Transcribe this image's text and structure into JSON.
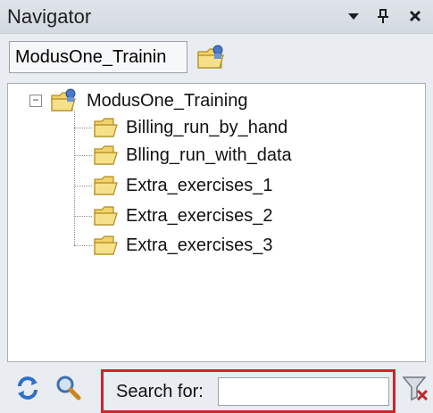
{
  "window": {
    "title": "Navigator"
  },
  "titlebar_icons": [
    "dropdown-arrow-icon",
    "pin-icon",
    "close-icon"
  ],
  "toolbar": {
    "root_value": "ModusOne_Trainin"
  },
  "tree": {
    "root": {
      "label": "ModusOne_Training",
      "expanded": true,
      "expander_glyph": "−"
    },
    "children": [
      {
        "label": "Billing_run_by_hand"
      },
      {
        "label": "Blling_run_with_data"
      },
      {
        "label": "Extra_exercises_1"
      },
      {
        "label": "Extra_exercises_2"
      },
      {
        "label": "Extra_exercises_3"
      }
    ]
  },
  "search": {
    "label": "Search for:",
    "value": ""
  },
  "colors": {
    "highlight": "#d0232b",
    "folder": "#f2d36b"
  }
}
